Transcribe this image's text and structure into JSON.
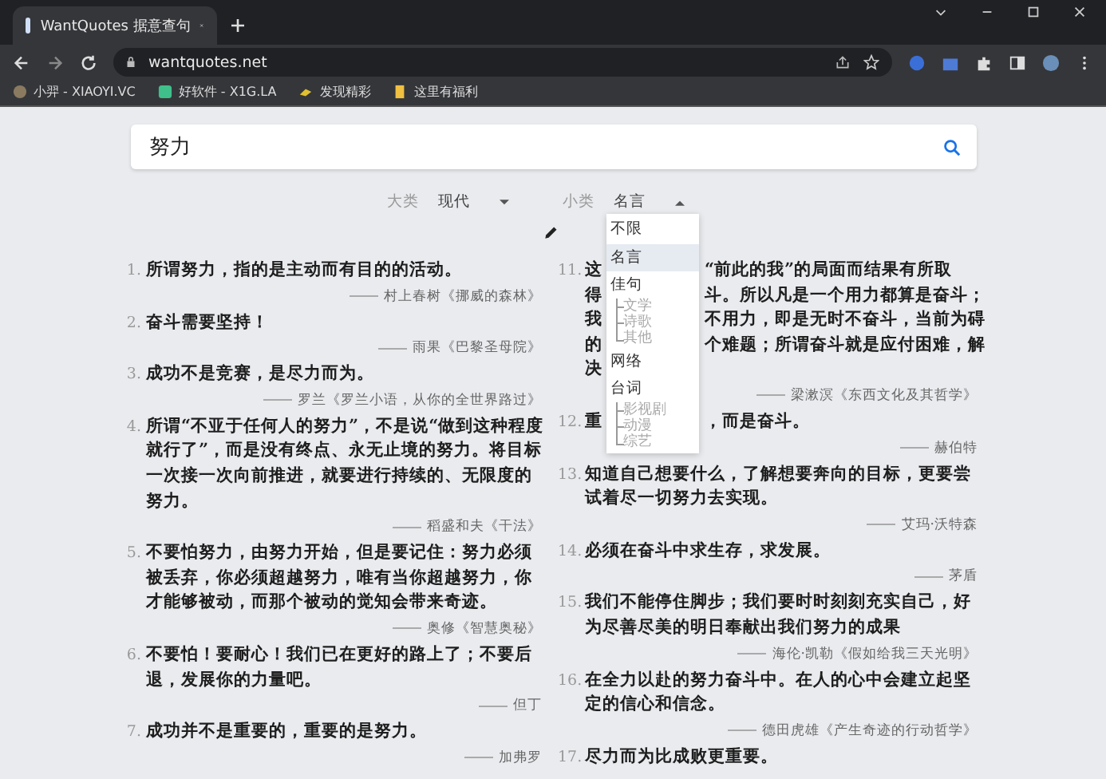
{
  "browser": {
    "tab_title": "WantQuotes 据意查句",
    "url": "wantquotes.net",
    "bookmarks": [
      {
        "label": "小羿 - XIAOYI.VC",
        "kind": "avatar"
      },
      {
        "label": "好软件 - X1G.LA",
        "kind": "app"
      },
      {
        "label": "发现精彩",
        "kind": "spark"
      },
      {
        "label": "这里有福利",
        "kind": "folder"
      }
    ]
  },
  "search": {
    "value": "努力"
  },
  "filters": [
    {
      "label": "大类",
      "value": "现代",
      "expanded": false
    },
    {
      "label": "小类",
      "value": "名言",
      "expanded": true
    }
  ],
  "dropdown": {
    "items": [
      {
        "label": "不限",
        "selected": false
      },
      {
        "label": "名言",
        "selected": true
      },
      {
        "label": "佳句",
        "selected": false,
        "children": [
          {
            "label": "文学",
            "selected": false
          },
          {
            "label": "诗歌",
            "selected": false
          },
          {
            "label": "其他",
            "selected": false
          }
        ]
      },
      {
        "label": "网络",
        "selected": false
      },
      {
        "label": "台词",
        "selected": false,
        "children": [
          {
            "label": "影视剧",
            "selected": false
          },
          {
            "label": "动漫",
            "selected": false
          },
          {
            "label": "综艺",
            "selected": false
          }
        ]
      }
    ]
  },
  "columns": [
    {
      "quotes": [
        {
          "number": "1.",
          "kind": "full",
          "text": "所谓努力，指的是主动而有目的的活动。",
          "source": "村上春树《挪威的森林》"
        },
        {
          "number": "2.",
          "kind": "full",
          "text": "奋斗需要坚持！",
          "source": "雨果《巴黎圣母院》"
        },
        {
          "number": "3.",
          "kind": "full",
          "text": "成功不是竞赛，是尽力而为。",
          "source": "罗兰《罗兰小语，从你的全世界路过》"
        },
        {
          "number": "4.",
          "kind": "full",
          "text": "所谓“不亚于任何人的努力”，不是说“做到这种程度就行了”，而是没有终点、永无止境的努力。将目标一次接一次向前推进，就要进行持续的、无限度的努力。",
          "source": "稻盛和夫《干法》"
        },
        {
          "number": "5.",
          "kind": "full",
          "text": "不要怕努力，由努力开始，但是要记住：努力必须被丢弃，你必须超越努力，唯有当你超越努力，你才能够被动，而那个被动的觉知会带来奇迹。",
          "source": "奥修《智慧奥秘》"
        },
        {
          "number": "6.",
          "kind": "full",
          "text": "不要怕！要耐心！我们已在更好的路上了；不要后退，发展你的力量吧。",
          "source": "但丁"
        },
        {
          "number": "7.",
          "kind": "full",
          "text": "成功并不是重要的，重要的是努力。",
          "source": "加弗罗"
        }
      ]
    },
    {
      "quotes": [
        {
          "number": "11.",
          "kind": "partial",
          "lines": [
            {
              "left": "这",
              "right": "“前此的我”的局面而结果有所取"
            },
            {
              "left": "得",
              "right": "斗。所以凡是一个用力都算是奋斗；"
            },
            {
              "left": "我",
              "right": "不用力，即是无时不奋斗，当前为碍"
            },
            {
              "left": "的",
              "right": "个难题；所谓奋斗就是应付困难，解"
            },
            {
              "left": "决"
            }
          ],
          "source": "梁漱溟《东西文化及其哲学》"
        },
        {
          "number": "12.",
          "kind": "partial",
          "lines": [
            {
              "left": "重",
              "right": "，而是奋斗。"
            }
          ],
          "source": "赫伯特"
        },
        {
          "number": "13.",
          "kind": "full",
          "text": "知道自己想要什么，了解想要奔向的目标，更要尝试着尽一切努力去实现。",
          "source": "艾玛·沃特森"
        },
        {
          "number": "14.",
          "kind": "full",
          "text": "必须在奋斗中求生存，求发展。",
          "source": "茅盾"
        },
        {
          "number": "15.",
          "kind": "full",
          "text": "我们不能停住脚步；我们要时时刻刻充实自己，好为尽善尽美的明日奉献出我们努力的成果",
          "source": "海伦·凯勒《假如给我三天光明》"
        },
        {
          "number": "16.",
          "kind": "full",
          "text": "在全力以赴的努力奋斗中。在人的心中会建立起坚定的信心和信念。",
          "source": "德田虎雄《产生奇迹的行动哲学》"
        },
        {
          "number": "17.",
          "kind": "full",
          "text": "尽力而为比成败更重要。"
        }
      ]
    }
  ]
}
